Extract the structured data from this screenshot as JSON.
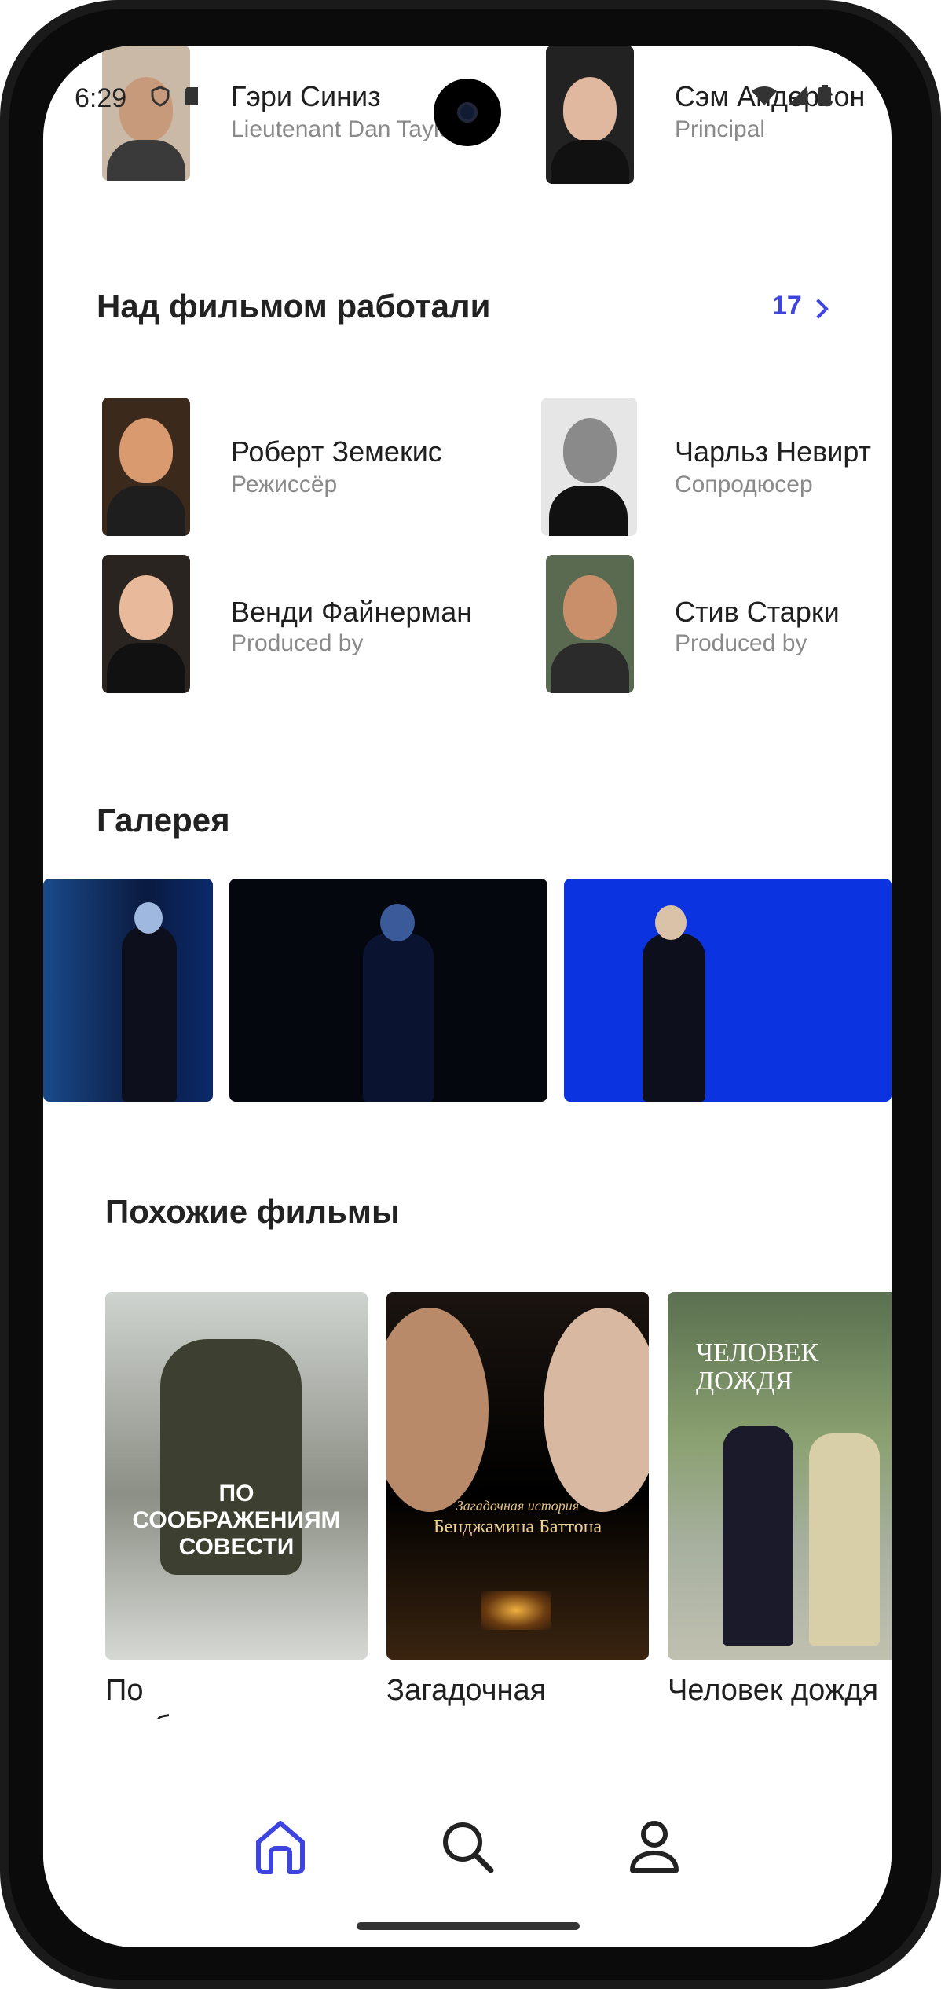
{
  "status_bar": {
    "time": "6:29"
  },
  "cast": [
    {
      "name": "Гэри Синиз",
      "role": "Lieutenant Dan Taylor"
    },
    {
      "name": "Сэм Андерсон",
      "role": "Principal"
    }
  ],
  "crew": {
    "title": "Над фильмом работали",
    "count": "17",
    "people": [
      {
        "name": "Роберт Земекис",
        "role": "Режиссёр"
      },
      {
        "name": "Чарльз Невирт",
        "role": "Сопродюсер"
      },
      {
        "name": "Венди Файнерман",
        "role": "Produced by"
      },
      {
        "name": "Стив Старки",
        "role": "Produced by"
      }
    ]
  },
  "gallery": {
    "title": "Галерея"
  },
  "similar": {
    "title": "Похожие фильмы",
    "movies": [
      {
        "title": "По соображениям совести",
        "poster_text": "ПО СООБРАЖЕНИЯМ СОВЕСТИ"
      },
      {
        "title": "Загадочная история Бенджамина Баттона",
        "poster_small": "Загадочная история",
        "poster_text": "Бенджамина Баттона"
      },
      {
        "title": "Человек дождя",
        "poster_text": "ЧЕЛОВЕК ДОЖДЯ"
      }
    ]
  },
  "nav": {
    "items": [
      "home-icon",
      "search-icon",
      "profile-icon"
    ],
    "active_color": "#3d44e0"
  }
}
